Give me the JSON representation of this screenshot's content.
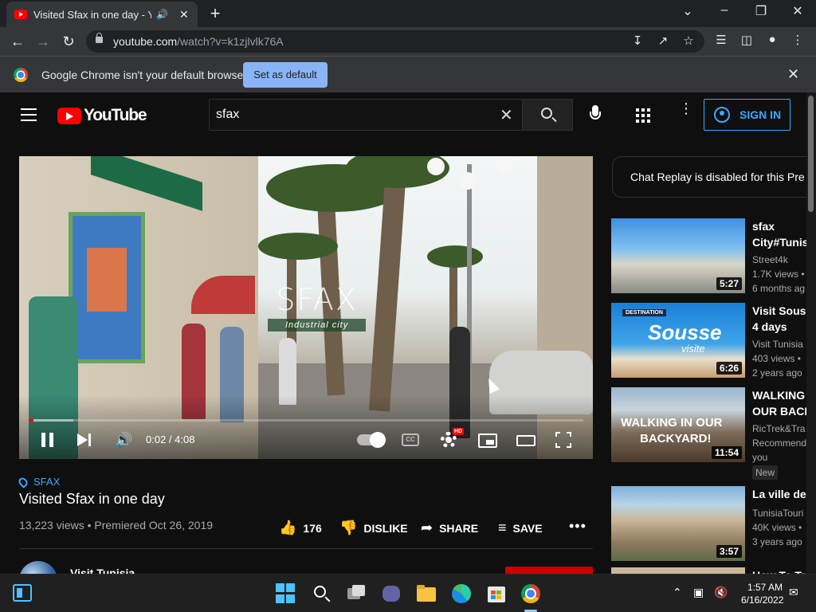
{
  "browser": {
    "tab": {
      "title": "Visited Sfax in one day - YouTube"
    },
    "url": {
      "host": "youtube.com",
      "path": "/watch?v=k1zjlvlk76A"
    },
    "infobar": {
      "message": "Google Chrome isn't your default browser",
      "button": "Set as default"
    }
  },
  "masthead": {
    "logo_text": "YouTube",
    "search_value": "sfax",
    "sign_in": "SIGN IN"
  },
  "player": {
    "overlay_city": "SFAX",
    "overlay_sub": "Industrial city",
    "time": "0:02 / 4:08",
    "progress_played": 0.008,
    "progress_loaded": 0.08,
    "hd_badge": "HD",
    "cc_label": "CC"
  },
  "video": {
    "hashtag": "SFAX",
    "title": "Visited Sfax in one day",
    "meta": "13,223 views • Premiered Oct 26, 2019",
    "likes": "176",
    "dislike": "DISLIKE",
    "share": "SHARE",
    "save": "SAVE",
    "channel": "Visit Tunisia"
  },
  "sidebar": {
    "chat_replay": "Chat Replay is disabled for this Pre",
    "recommendations": [
      {
        "title_1": "sfax",
        "title_2": "City#Tunis",
        "channel": "Street4k",
        "views": "1.7K views •",
        "age": "6 months ag",
        "duration": "5:27"
      },
      {
        "title_1": "Visit Sous",
        "title_2": "4 days",
        "channel": "Visit Tunisia",
        "views": "403 views •",
        "age": "2 years ago",
        "duration": "6:26",
        "thumb_text": "Sousse",
        "thumb_sub": "visite",
        "thumb_tag": "DESTINATION"
      },
      {
        "title_1": "WALKING",
        "title_2": "OUR BACK",
        "channel": "RicTrek&Tra",
        "views": "Recommend",
        "age": "you",
        "badge": "New",
        "duration": "11:54",
        "thumb_text": "WALKING IN OUR",
        "thumb_sub": "BACKYARD!"
      },
      {
        "title_1": "La ville de",
        "title_2": "",
        "channel": "TunisiaTouri",
        "views": "40K views •",
        "age": "3 years ago",
        "duration": "3:57"
      },
      {
        "title_1": "How To Tr",
        "title_2": "",
        "channel": "",
        "views": "",
        "age": "",
        "duration": ""
      }
    ]
  },
  "taskbar": {
    "time": "1:57 AM",
    "date": "6/16/2022"
  },
  "colors": {
    "accent": "#3ea6ff",
    "youtube_red": "#ff0000",
    "chrome_blue": "#8ab4f8"
  }
}
